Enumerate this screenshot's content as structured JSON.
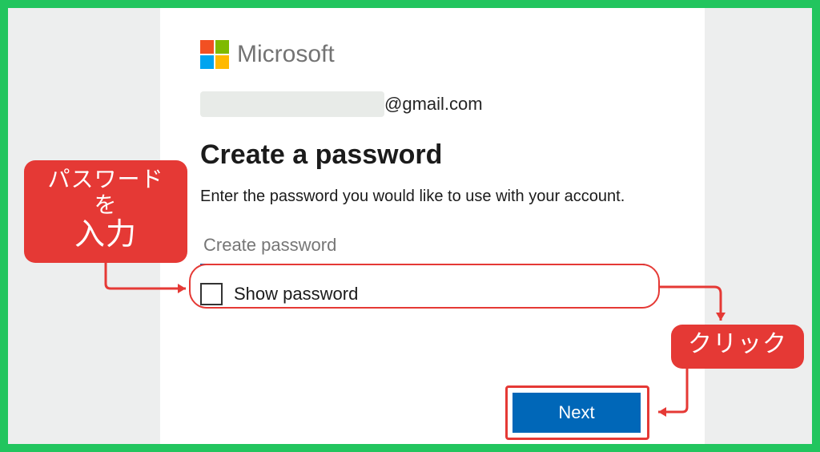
{
  "logo": {
    "text": "Microsoft"
  },
  "email": {
    "domain": "@gmail.com"
  },
  "heading": "Create a password",
  "description": "Enter the password you would like to use with your account.",
  "password_input": {
    "placeholder": "Create password",
    "value": ""
  },
  "show_password": {
    "label": "Show password",
    "checked": false
  },
  "next_button": {
    "label": "Next"
  },
  "annotations": {
    "password_hint_line1": "パスワードを",
    "password_hint_line2": "入力",
    "click_hint": "クリック"
  },
  "colors": {
    "accent": "#0067b8",
    "annotation": "#e53935",
    "frame": "#22c55e"
  }
}
